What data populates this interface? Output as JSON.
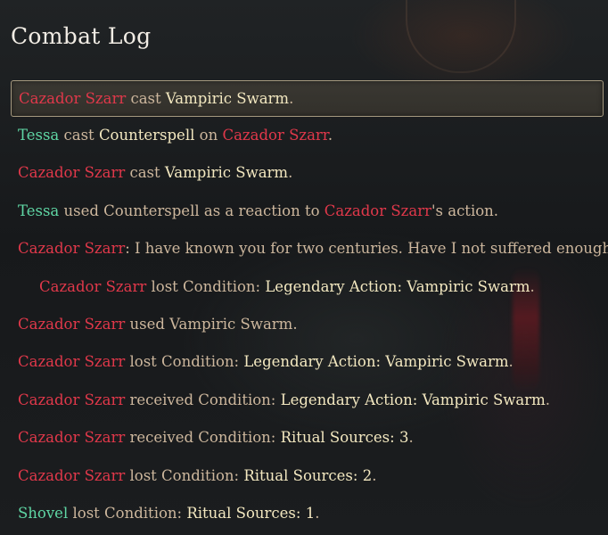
{
  "panel": {
    "title": "Combat Log"
  },
  "entries": [
    {
      "actor": "Cazador Szarr",
      "t1": " cast ",
      "a1": "Vampiric Swarm",
      "t2": ".",
      "selected": true
    },
    {
      "actor": "Tessa",
      "t1": " cast ",
      "a1": "Counterspell",
      "t2": " on ",
      "target": "Cazador Szarr",
      "t3": "."
    },
    {
      "actor": "Cazador Szarr",
      "t1": " cast ",
      "a1": "Vampiric Swarm",
      "t2": "."
    },
    {
      "actor": "Tessa",
      "t1": " used Counterspell as a reaction to ",
      "target": "Cazador Szarr",
      "t2": "'s action."
    },
    {
      "actor": "Cazador Szarr",
      "t1": ": I have known you for two centuries. Have I not suffered enough?"
    },
    {
      "actor": "Cazador Szarr",
      "t1": " lost Condition: ",
      "a1": "Legendary Action: Vampiric Swarm",
      "t2": ".",
      "indent": true
    },
    {
      "actor": "Cazador Szarr",
      "t1": " used Vampiric Swarm."
    },
    {
      "actor": "Cazador Szarr",
      "t1": " lost Condition: ",
      "a1": "Legendary Action: Vampiric Swarm",
      "t2": "."
    },
    {
      "actor": "Cazador Szarr",
      "t1": " received Condition: ",
      "a1": "Legendary Action: Vampiric Swarm",
      "t2": "."
    },
    {
      "actor": "Cazador Szarr",
      "t1": " received Condition: ",
      "a1": "Ritual Sources: 3",
      "t2": "."
    },
    {
      "actor": "Cazador Szarr",
      "t1": " lost Condition: ",
      "a1": "Ritual Sources: 2",
      "t2": "."
    },
    {
      "actor": "Shovel",
      "t1": " lost Condition: ",
      "a1": "Ritual Sources: 1",
      "t2": "."
    }
  ],
  "colors": {
    "enemy": "#e0384a",
    "ally": "#5fd6a4",
    "highlight": "#f3e8c0",
    "text": "#cdb79d"
  }
}
